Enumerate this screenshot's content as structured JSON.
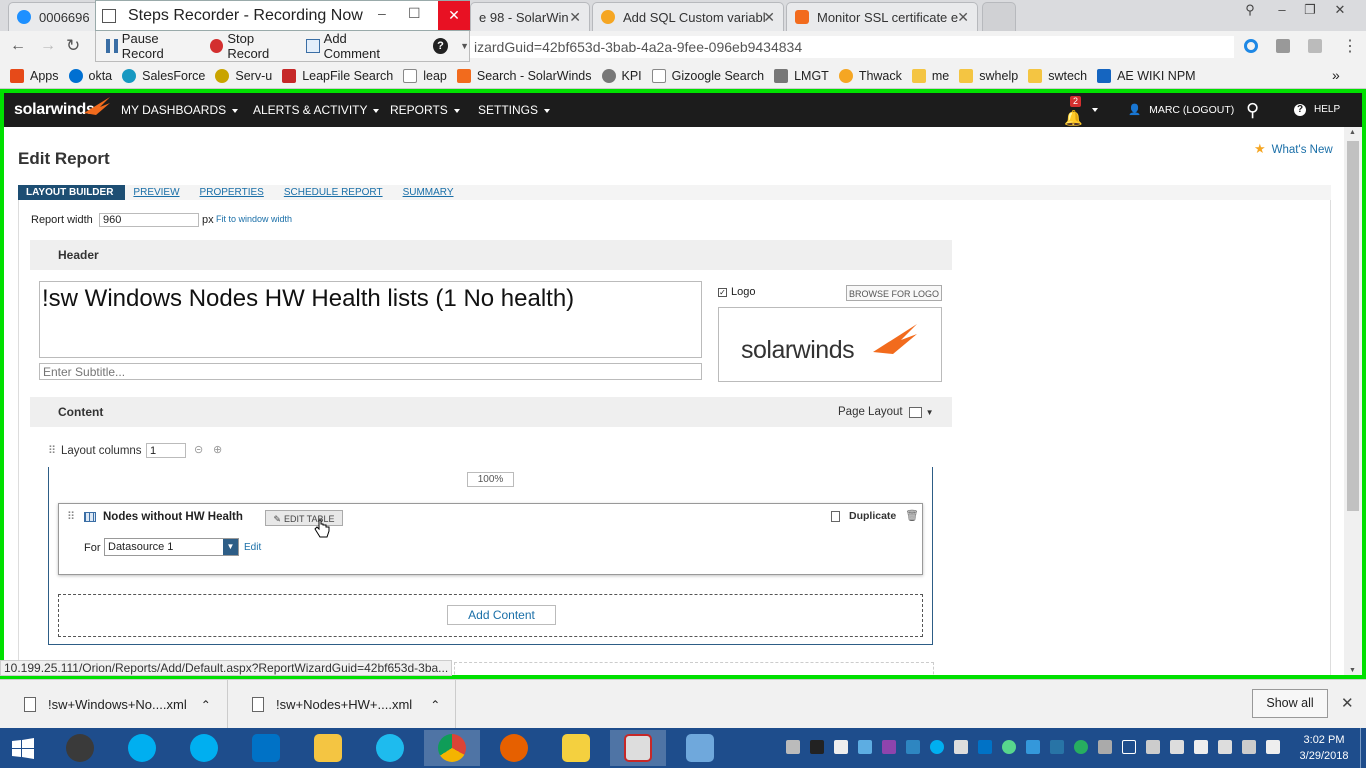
{
  "chrome": {
    "tabs": [
      {
        "title": "0006696",
        "color": "#1e90ff"
      },
      {
        "title": "e 98 - SolarWin",
        "color": "#1e90ff"
      },
      {
        "title": "Add SQL Custom variabl",
        "color": "#f5a623"
      },
      {
        "title": "Monitor SSL certificate e",
        "color": "#f26b1d"
      }
    ],
    "address": "izardGuid=42bf653d-3bab-4a2a-9fee-096eb9434834",
    "bookmarks": [
      {
        "label": "Apps",
        "color": "#e64a19"
      },
      {
        "label": "okta",
        "color": "#0070d2"
      },
      {
        "label": "SalesForce",
        "color": "#1798c1"
      },
      {
        "label": "Serv-u",
        "color": "#c9a400"
      },
      {
        "label": "LeapFile Search",
        "color": "#c62828"
      },
      {
        "label": "leap",
        "color": "#888888"
      },
      {
        "label": "Search - SolarWinds",
        "color": "#f26b1d"
      },
      {
        "label": "KPI",
        "color": "#777777"
      },
      {
        "label": "Gizoogle Search",
        "color": "#999999"
      },
      {
        "label": "LMGT",
        "color": "#777777"
      },
      {
        "label": "Thwack",
        "color": "#f5a623"
      },
      {
        "label": "me",
        "color": "#f4c542"
      },
      {
        "label": "swhelp",
        "color": "#f4c542"
      },
      {
        "label": "swtech",
        "color": "#f4c542"
      },
      {
        "label": "AE WIKI NPM",
        "color": "#1565c0"
      }
    ],
    "more_bookmarks": "»"
  },
  "steps_recorder": {
    "title": "Steps Recorder - Recording Now",
    "pause": "Pause Record",
    "stop": "Stop Record",
    "comment": "Add Comment",
    "help": "?",
    "minimize": "–",
    "maximize": "☐",
    "close": "✕"
  },
  "nav": {
    "logo": "solarwinds",
    "menus": [
      "MY DASHBOARDS",
      "ALERTS & ACTIVITY",
      "REPORTS",
      "SETTINGS"
    ],
    "notif_count": "2",
    "user": "MARC (LOGOUT)",
    "help": "HELP"
  },
  "report": {
    "page_title": "Edit Report",
    "whats_new": "What's New",
    "steps": [
      "LAYOUT BUILDER",
      "PREVIEW",
      "PROPERTIES",
      "SCHEDULE REPORT",
      "SUMMARY"
    ],
    "width_label": "Report width",
    "width_value": "960",
    "px": "px",
    "fit": "Fit to window width",
    "header_label": "Header",
    "title_value": "!sw Windows Nodes HW Health lists (1 No health)",
    "subtitle_placeholder": "Enter Subtitle...",
    "logo_label": "Logo",
    "browse_logo": "BROWSE FOR LOGO",
    "logo_text": "solarwinds",
    "content_label": "Content",
    "page_layout": "Page Layout",
    "layout_columns_label": "Layout columns",
    "layout_columns_value": "1",
    "column_width": "100%",
    "widget_title": "Nodes without HW Health",
    "edit_table": "EDIT TABLE",
    "for_label": "For",
    "datasource": "Datasource 1",
    "edit": "Edit",
    "duplicate": "Duplicate",
    "add_content": "Add Content"
  },
  "status_url": "10.199.25.111/Orion/Reports/Add/Default.aspx?ReportWizardGuid=42bf653d-3ba...",
  "downloads": {
    "items": [
      "!sw+Windows+No....xml",
      "!sw+Nodes+HW+....xml"
    ],
    "show_all": "Show all"
  },
  "taskbar": {
    "time": "3:02 PM",
    "date": "3/29/2018"
  },
  "colors": {
    "accent_orange": "#f26b1d",
    "nav_bg": "#1c1c1c",
    "link_blue": "#1a6fa8",
    "frame_green": "#00e000"
  }
}
